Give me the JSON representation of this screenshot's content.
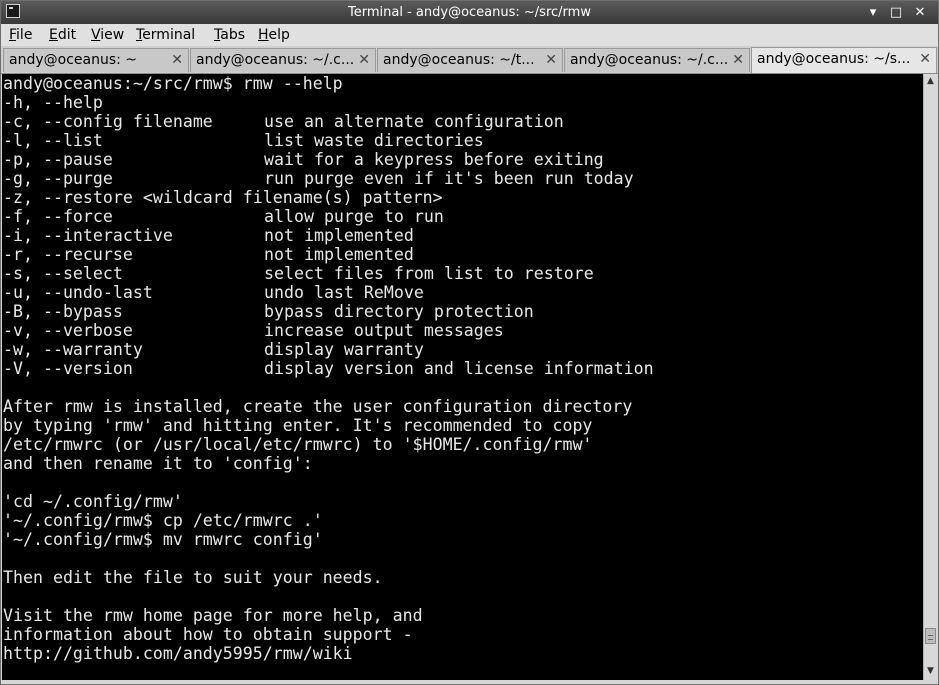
{
  "window": {
    "title": "Terminal - andy@oceanus: ~/src/rmw",
    "buttons": {
      "minimize": "▾",
      "maximize": "□",
      "close": "✕"
    }
  },
  "menu": [
    {
      "accel": "F",
      "rest": "ile"
    },
    {
      "accel": "E",
      "rest": "dit"
    },
    {
      "accel": "V",
      "rest": "iew"
    },
    {
      "accel": "T",
      "rest": "erminal"
    },
    {
      "accel": "T",
      "rest": "abs"
    },
    {
      "accel": "H",
      "rest": "elp"
    }
  ],
  "tabs": [
    {
      "label": "andy@oceanus: ~",
      "close": "✕",
      "active": false
    },
    {
      "label": "andy@oceanus: ~/.c...",
      "close": "✕",
      "active": false
    },
    {
      "label": "andy@oceanus: ~/t...",
      "close": "✕",
      "active": false
    },
    {
      "label": "andy@oceanus: ~/.c...",
      "close": "✕",
      "active": false
    },
    {
      "label": "andy@oceanus: ~/s...",
      "close": "✕",
      "active": true
    }
  ],
  "terminal": {
    "lines": [
      {
        "a": "andy@oceanus:~/src/rmw$ rmw --help",
        "b": ""
      },
      {
        "a": "-h, --help",
        "b": ""
      },
      {
        "a": "-c, --config filename",
        "b": "use an alternate configuration"
      },
      {
        "a": "-l, --list",
        "b": "list waste directories"
      },
      {
        "a": "-p, --pause",
        "b": "wait for a keypress before exiting"
      },
      {
        "a": "-g, --purge",
        "b": "run purge even if it's been run today"
      },
      {
        "a": "-z, --restore <wildcard filename(s) pattern>",
        "b": ""
      },
      {
        "a": "-f, --force",
        "b": "allow purge to run"
      },
      {
        "a": "-i, --interactive",
        "b": "not implemented"
      },
      {
        "a": "-r, --recurse",
        "b": "not implemented"
      },
      {
        "a": "-s, --select",
        "b": "select files from list to restore"
      },
      {
        "a": "-u, --undo-last",
        "b": "undo last ReMove"
      },
      {
        "a": "-B, --bypass",
        "b": "bypass directory protection"
      },
      {
        "a": "-v, --verbose",
        "b": "increase output messages"
      },
      {
        "a": "-w, --warranty",
        "b": "display warranty"
      },
      {
        "a": "-V, --version",
        "b": "display version and license information"
      },
      {
        "a": "",
        "b": ""
      },
      {
        "a": "After rmw is installed, create the user configuration directory",
        "b": ""
      },
      {
        "a": "by typing 'rmw' and hitting enter. It's recommended to copy",
        "b": ""
      },
      {
        "a": "/etc/rmwrc (or /usr/local/etc/rmwrc) to '$HOME/.config/rmw'",
        "b": ""
      },
      {
        "a": "and then rename it to 'config':",
        "b": ""
      },
      {
        "a": "",
        "b": ""
      },
      {
        "a": "'cd ~/.config/rmw'",
        "b": ""
      },
      {
        "a": "'~/.config/rmw$ cp /etc/rmwrc .'",
        "b": ""
      },
      {
        "a": "'~/.config/rmw$ mv rmwrc config'",
        "b": ""
      },
      {
        "a": "",
        "b": ""
      },
      {
        "a": "Then edit the file to suit your needs.",
        "b": ""
      },
      {
        "a": "",
        "b": ""
      },
      {
        "a": "Visit the rmw home page for more help, and",
        "b": ""
      },
      {
        "a": "information about how to obtain support -",
        "b": ""
      },
      {
        "a": "http://github.com/andy5995/rmw/wiki",
        "b": ""
      }
    ]
  },
  "scrollbar": {
    "up_arrow": "▲",
    "down_arrow": "▼",
    "position": 0.96
  },
  "colors": {
    "terminal_bg": "#000000",
    "terminal_fg": "#e8e8e8",
    "titlebar": "#4a4a4a"
  }
}
